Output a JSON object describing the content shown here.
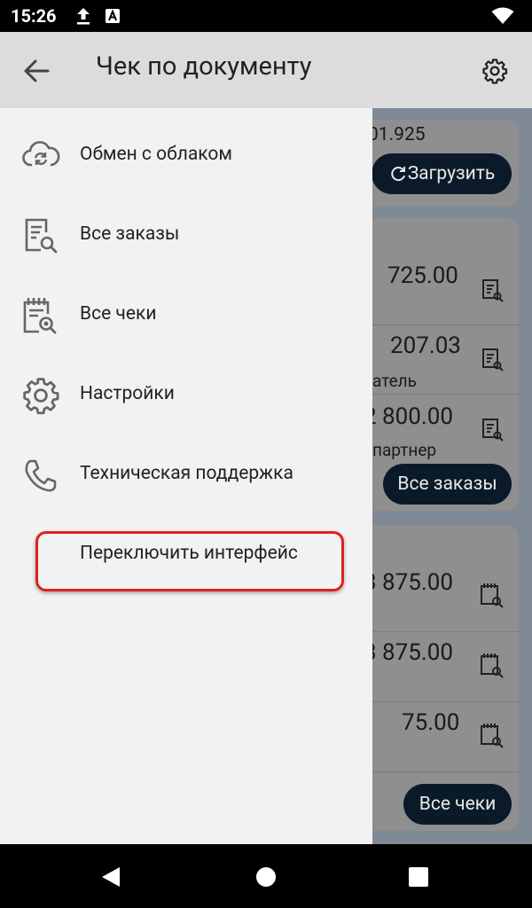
{
  "status_bar": {
    "time": "15:26"
  },
  "app_bar": {
    "title": "Чек по документу"
  },
  "drawer": {
    "items": [
      {
        "label": "Обмен с облаком",
        "icon": "cloud-sync-icon"
      },
      {
        "label": "Все заказы",
        "icon": "order-search-icon"
      },
      {
        "label": "Все чеки",
        "icon": "receipt-search-icon"
      },
      {
        "label": "Настройки",
        "icon": "gear-icon"
      },
      {
        "label": "Техническая поддержка",
        "icon": "phone-icon"
      },
      {
        "label": "Переключить интерфейс",
        "icon": ""
      }
    ]
  },
  "background": {
    "sync_value": "01.925",
    "load_button": "Загрузить",
    "orders": [
      {
        "amount": "725.00",
        "sub": ""
      },
      {
        "amount": "207.03",
        "sub": "атель"
      },
      {
        "amount": "2 800.00",
        "sub": "партнер"
      }
    ],
    "all_orders_button": "Все заказы",
    "receipts": [
      {
        "amount": "3 875.00"
      },
      {
        "amount": "3 875.00"
      },
      {
        "amount": "75.00"
      }
    ],
    "all_receipts_button": "Все чеки"
  },
  "colors": {
    "highlight": "#e02020",
    "drawer_bg": "#f2f2f2",
    "appbar_bg": "#dcdcdc"
  }
}
